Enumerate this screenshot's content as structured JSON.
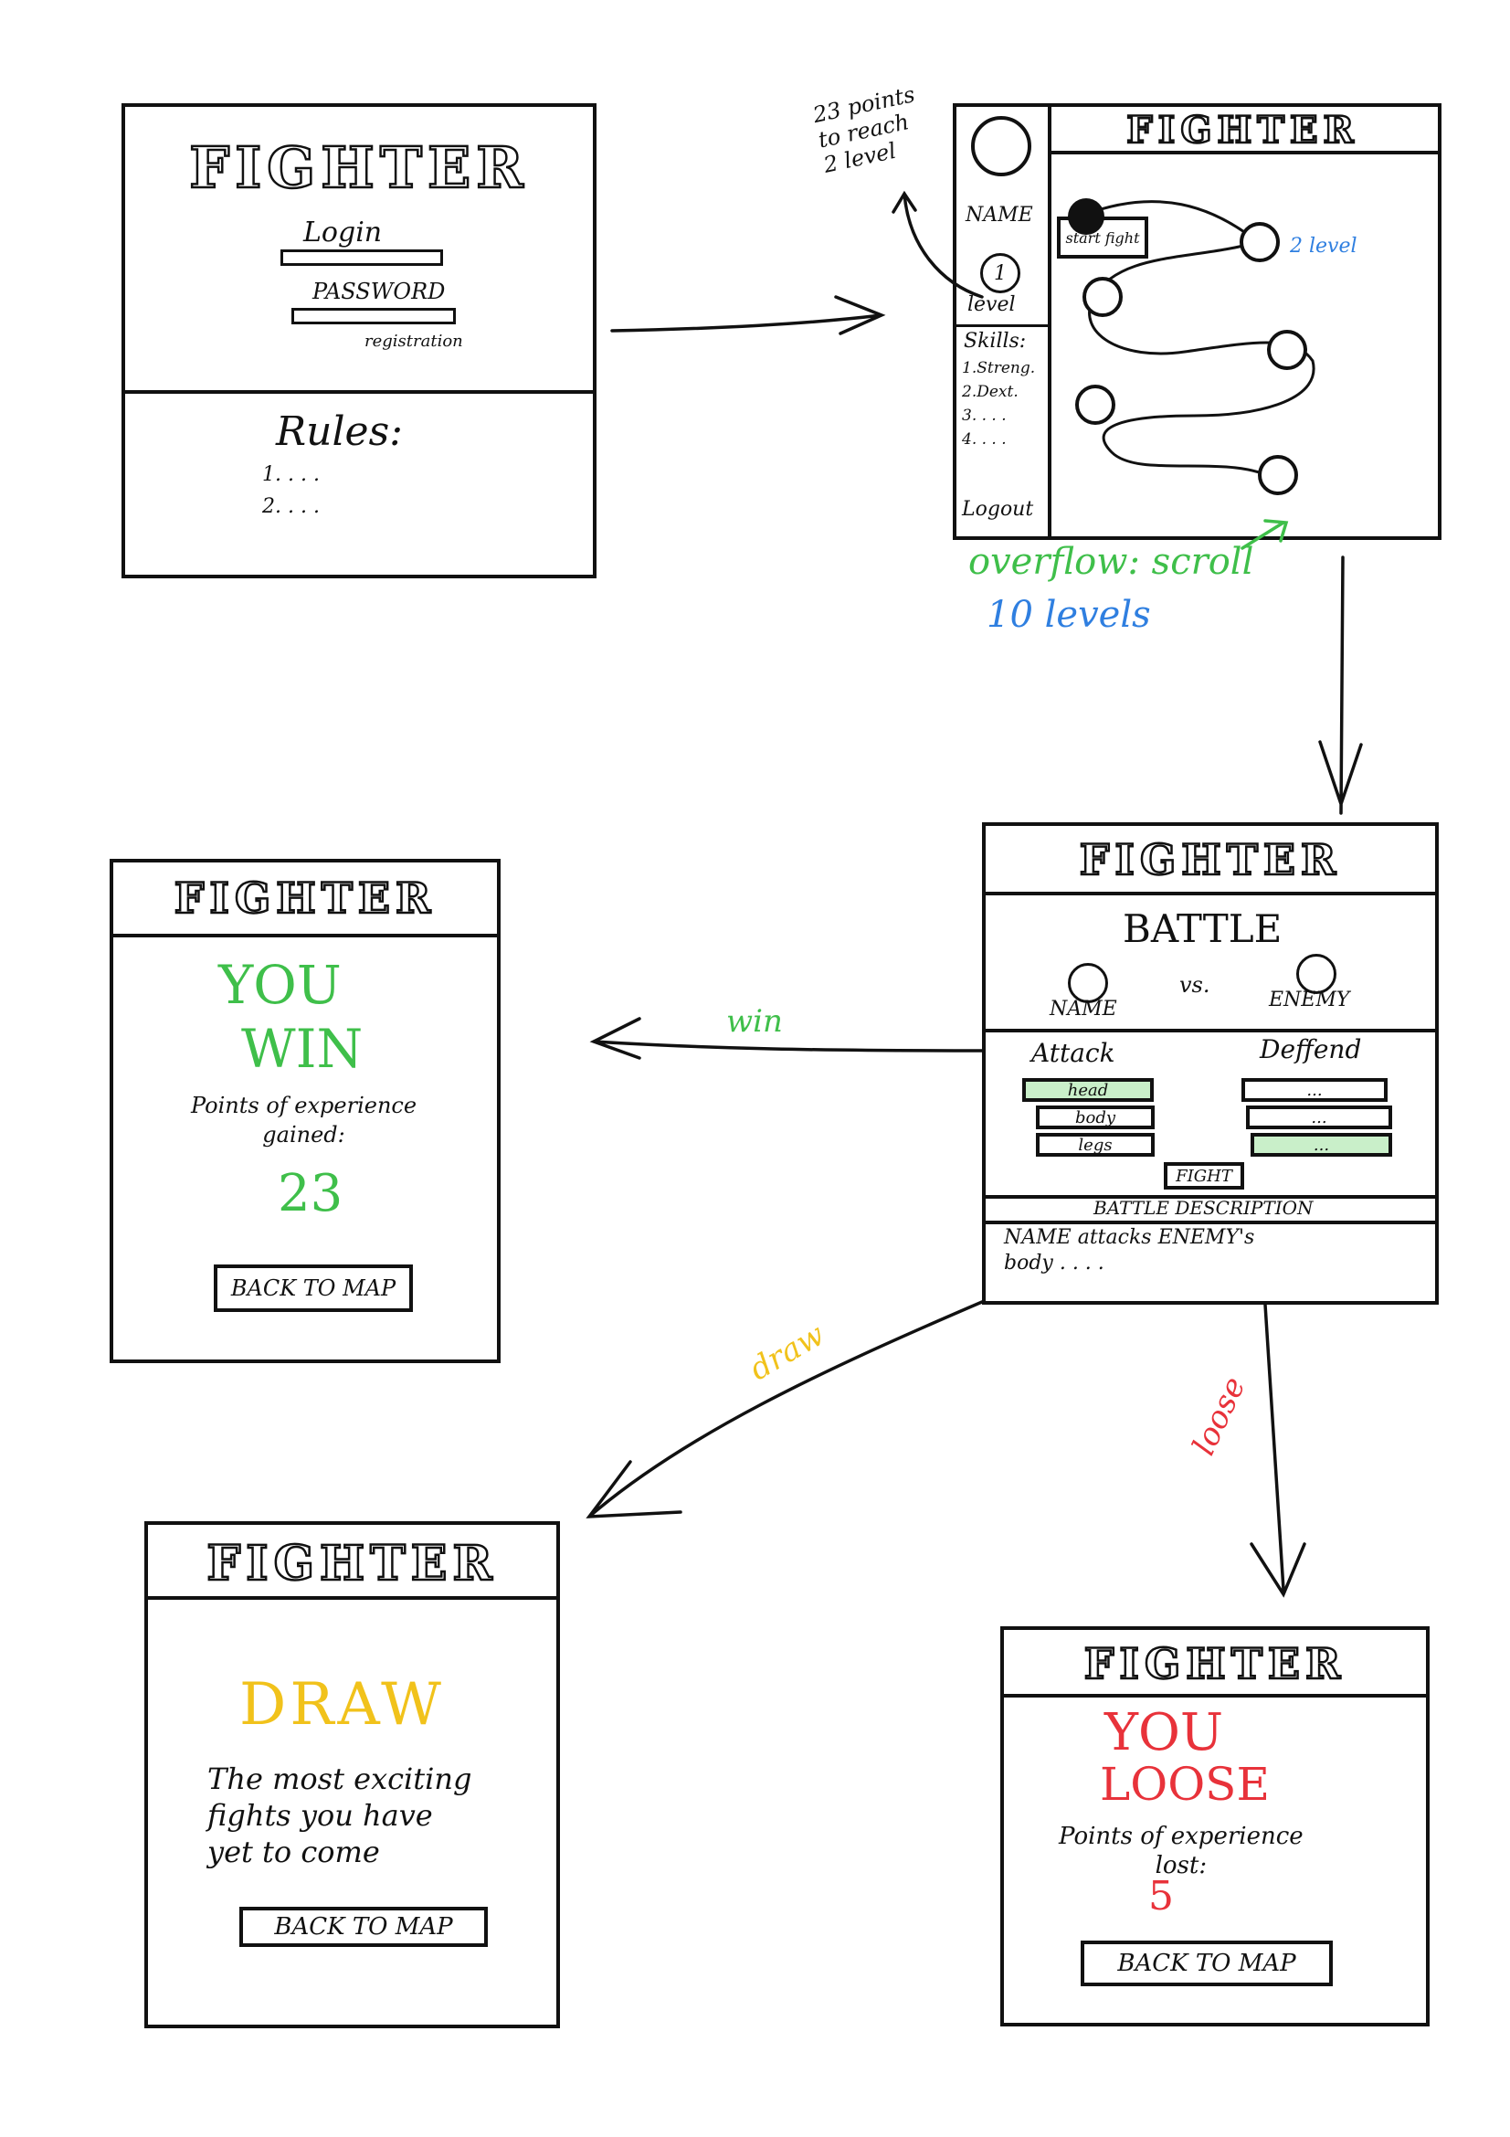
{
  "colors": {
    "ink": "#111111",
    "green": "#3fbf4a",
    "blue": "#2f7fe0",
    "red": "#e8323a",
    "yellow": "#f1c21b",
    "highlight": "#c9efc9"
  },
  "login": {
    "title": "FIGHTER",
    "login_label": "Login",
    "password_label": "PASSWORD",
    "registration_link": "registration",
    "rules_title": "Rules:",
    "rules_items": [
      "1. . . .",
      "2. . . ."
    ]
  },
  "map": {
    "title": "FIGHTER",
    "note": [
      "23 points",
      "to reach",
      "2 level"
    ],
    "sidebar": {
      "name": "NAME",
      "level_number": "1",
      "level_label": "level",
      "skills_title": "Skills:",
      "skills": [
        "1.Streng.",
        "2.Dext.",
        "3. . . .",
        "4. . . ."
      ],
      "logout": "Logout"
    },
    "start_fight": "start fight",
    "level_note": "2 level",
    "overflow_note": "overflow: scroll",
    "levels_note": "10 levels"
  },
  "battle": {
    "title": "FIGHTER",
    "heading": "BATTLE",
    "player": "NAME",
    "vs": "vs.",
    "enemy": "ENEMY",
    "attack_label": "Attack",
    "defend_label": "Deffend",
    "attack_options": [
      "head",
      "body",
      "legs"
    ],
    "defend_options": [
      "...",
      "...",
      "..."
    ],
    "fight_button": "FIGHT",
    "description_title": "BATTLE DESCRIPTION",
    "description_text": [
      "NAME attacks ENEMY's",
      "body . . . ."
    ]
  },
  "win": {
    "title": "FIGHTER",
    "line1": "YOU",
    "line2": "WIN",
    "points_text": [
      "Points of experience",
      "gained:"
    ],
    "points": "23",
    "back_button": "BACK TO MAP",
    "arrow_label": "win"
  },
  "draw": {
    "title": "FIGHTER",
    "result": "DRAW",
    "message": [
      "The most exciting",
      "fights you have",
      "yet to come"
    ],
    "back_button": "BACK TO MAP",
    "arrow_label": "draw"
  },
  "lose": {
    "title": "FIGHTER",
    "line1": "YOU",
    "line2": "LOOSE",
    "points_text": [
      "Points of experience",
      "lost:"
    ],
    "points": "5",
    "back_button": "BACK TO MAP",
    "arrow_label": "loose"
  }
}
